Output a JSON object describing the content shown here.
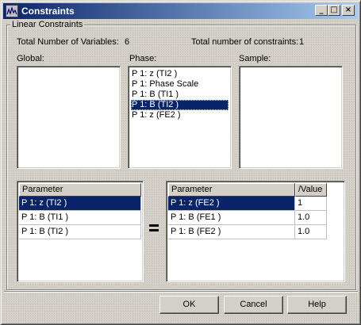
{
  "window": {
    "title": "Constraints",
    "controls": {
      "minimize": "_",
      "maximize": "□",
      "close": "×"
    }
  },
  "group": {
    "label": "Linear Constraints"
  },
  "summary": {
    "variables_label": "Total Number of Variables:",
    "variables_value": "6",
    "constraints_label": "Total number of constraints:",
    "constraints_value": "1"
  },
  "lists": {
    "global": {
      "label": "Global:",
      "items": []
    },
    "phase": {
      "label": "Phase:",
      "items": [
        "P 1: z (TI2 )",
        "P 1: Phase Scale",
        "P 1: B (TI1 )",
        "P 1: B (TI2 )",
        "P 1: z (FE2 )"
      ],
      "selected_index": 3
    },
    "sample": {
      "label": "Sample:",
      "items": []
    }
  },
  "left_table": {
    "header": "Parameter",
    "rows": [
      "P 1: z (TI2 )",
      "P 1: B (TI1 )",
      "P 1: B (TI2 )"
    ],
    "selected_index": 0
  },
  "equals_symbol": "=",
  "right_table": {
    "headers": [
      "Parameter",
      "/Value"
    ],
    "rows": [
      {
        "parameter": "P 1: z (FE2 )",
        "value": "1"
      },
      {
        "parameter": "P 1: B (FE1 )",
        "value": "1.0"
      },
      {
        "parameter": "P 1: B (FE2 )",
        "value": "1.0"
      }
    ],
    "selected_index": 0
  },
  "buttons": {
    "ok": "OK",
    "cancel": "Cancel",
    "help": "Help"
  },
  "colors": {
    "face": "#d4d0c8",
    "selection": "#0a246a",
    "title_start": "#0a246a",
    "title_end": "#a6caf0"
  }
}
